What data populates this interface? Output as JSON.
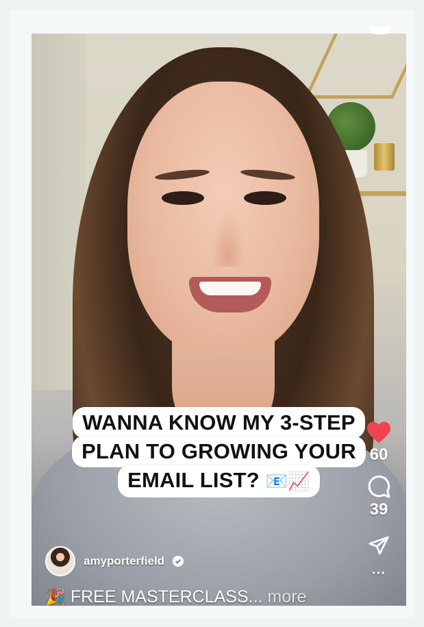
{
  "caption": {
    "line1": "WANNA KNOW MY 3-STEP",
    "line2": "PLAN TO GROWING YOUR",
    "line3_text": "EMAIL LIST? ",
    "line3_emoji": "📧📈"
  },
  "actions": {
    "likes_count": "60",
    "comments_count": "39",
    "more_glyph": "···"
  },
  "post": {
    "username": "amyporterfield",
    "description_emoji": "🎉",
    "description": "FREE MASTERCLASS...",
    "more_label": "more"
  },
  "colors": {
    "like": "#f0434f",
    "icon": "#ffffff",
    "background": "#eef3f3"
  },
  "icons": {
    "like": "heart-icon",
    "comment": "comment-bubble-icon",
    "share": "paper-plane-icon",
    "more": "more-dots-icon",
    "verified": "verified-badge-icon"
  }
}
